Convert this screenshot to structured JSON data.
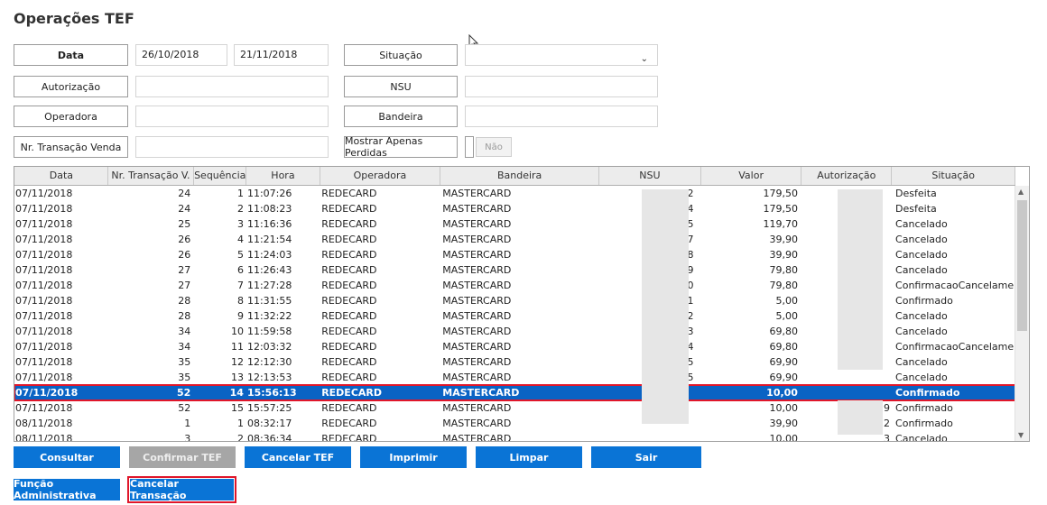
{
  "title": "Operações TEF",
  "filters": {
    "data_label": "Data",
    "date_from": "26/10/2018",
    "date_to": "21/11/2018",
    "autorizacao_label": "Autorização",
    "operadora_label": "Operadora",
    "nr_transacao_label": "Nr. Transação Venda",
    "situacao_label": "Situação",
    "nsu_label": "NSU",
    "bandeira_label": "Bandeira",
    "mostrar_perdidas_label": "Mostrar Apenas Perdidas",
    "mostrar_perdidas_value": "Não"
  },
  "grid": {
    "columns": [
      "Data",
      "Nr. Transação V.",
      "Sequência",
      "Hora",
      "Operadora",
      "Bandeira",
      "NSU",
      "Valor",
      "Autorização",
      "Situação"
    ],
    "rows": [
      {
        "data": "07/11/2018",
        "nr": "24",
        "seq": "1",
        "hora": "11:07:26",
        "op": "REDECARD",
        "band": "MASTERCARD",
        "nsu": "2",
        "valor": "179,50",
        "aut": "",
        "sit": "Desfeita"
      },
      {
        "data": "07/11/2018",
        "nr": "24",
        "seq": "2",
        "hora": "11:08:23",
        "op": "REDECARD",
        "band": "MASTERCARD",
        "nsu": "4",
        "valor": "179,50",
        "aut": "",
        "sit": "Desfeita"
      },
      {
        "data": "07/11/2018",
        "nr": "25",
        "seq": "3",
        "hora": "11:16:36",
        "op": "REDECARD",
        "band": "MASTERCARD",
        "nsu": "5",
        "valor": "119,70",
        "aut": "",
        "sit": "Cancelado"
      },
      {
        "data": "07/11/2018",
        "nr": "26",
        "seq": "4",
        "hora": "11:21:54",
        "op": "REDECARD",
        "band": "MASTERCARD",
        "nsu": "7",
        "valor": "39,90",
        "aut": "",
        "sit": "Cancelado"
      },
      {
        "data": "07/11/2018",
        "nr": "26",
        "seq": "5",
        "hora": "11:24:03",
        "op": "REDECARD",
        "band": "MASTERCARD",
        "nsu": "8",
        "valor": "39,90",
        "aut": "",
        "sit": "Cancelado"
      },
      {
        "data": "07/11/2018",
        "nr": "27",
        "seq": "6",
        "hora": "11:26:43",
        "op": "REDECARD",
        "band": "MASTERCARD",
        "nsu": "9",
        "valor": "79,80",
        "aut": "",
        "sit": "Cancelado"
      },
      {
        "data": "07/11/2018",
        "nr": "27",
        "seq": "7",
        "hora": "11:27:28",
        "op": "REDECARD",
        "band": "MASTERCARD",
        "nsu": "0",
        "valor": "79,80",
        "aut": "",
        "sit": "ConfirmacaoCancelamento"
      },
      {
        "data": "07/11/2018",
        "nr": "28",
        "seq": "8",
        "hora": "11:31:55",
        "op": "REDECARD",
        "band": "MASTERCARD",
        "nsu": "1",
        "valor": "5,00",
        "aut": "",
        "sit": "Confirmado"
      },
      {
        "data": "07/11/2018",
        "nr": "28",
        "seq": "9",
        "hora": "11:32:22",
        "op": "REDECARD",
        "band": "MASTERCARD",
        "nsu": "2",
        "valor": "5,00",
        "aut": "",
        "sit": "Cancelado"
      },
      {
        "data": "07/11/2018",
        "nr": "34",
        "seq": "10",
        "hora": "11:59:58",
        "op": "REDECARD",
        "band": "MASTERCARD",
        "nsu": "3",
        "valor": "69,80",
        "aut": "",
        "sit": "Cancelado"
      },
      {
        "data": "07/11/2018",
        "nr": "34",
        "seq": "11",
        "hora": "12:03:32",
        "op": "REDECARD",
        "band": "MASTERCARD",
        "nsu": "4",
        "valor": "69,80",
        "aut": "",
        "sit": "ConfirmacaoCancelamento"
      },
      {
        "data": "07/11/2018",
        "nr": "35",
        "seq": "12",
        "hora": "12:12:30",
        "op": "REDECARD",
        "band": "MASTERCARD",
        "nsu": "5",
        "valor": "69,90",
        "aut": "",
        "sit": "Cancelado"
      },
      {
        "data": "07/11/2018",
        "nr": "35",
        "seq": "13",
        "hora": "12:13:53",
        "op": "REDECARD",
        "band": "MASTERCARD",
        "nsu": "5",
        "valor": "69,90",
        "aut": "",
        "sit": "Cancelado"
      },
      {
        "data": "07/11/2018",
        "nr": "52",
        "seq": "14",
        "hora": "15:56:13",
        "op": "REDECARD",
        "band": "MASTERCARD",
        "nsu": "",
        "valor": "10,00",
        "aut": "",
        "sit": "Confirmado",
        "selected": true
      },
      {
        "data": "07/11/2018",
        "nr": "52",
        "seq": "15",
        "hora": "15:57:25",
        "op": "REDECARD",
        "band": "MASTERCARD",
        "nsu": "",
        "valor": "10,00",
        "aut": "9",
        "sit": "Confirmado"
      },
      {
        "data": "08/11/2018",
        "nr": "1",
        "seq": "1",
        "hora": "08:32:17",
        "op": "REDECARD",
        "band": "MASTERCARD",
        "nsu": "",
        "valor": "39,90",
        "aut": "2",
        "sit": "Confirmado"
      },
      {
        "data": "08/11/2018",
        "nr": "3",
        "seq": "2",
        "hora": "08:36:34",
        "op": "REDECARD",
        "band": "MASTERCARD",
        "nsu": "",
        "valor": "10,00",
        "aut": "3",
        "sit": "Cancelado"
      }
    ]
  },
  "buttons": {
    "consultar": "Consultar",
    "confirmar_tef": "Confirmar TEF",
    "cancelar_tef": "Cancelar TEF",
    "imprimir": "Imprimir",
    "limpar": "Limpar",
    "sair": "Sair",
    "funcao_admin": "Função Administrativa",
    "cancelar_transacao": "Cancelar Transação"
  },
  "colors": {
    "button_blue": "#0a74d6",
    "selected_row": "#0a63c4",
    "highlight_red": "#e0162a",
    "disabled_gray": "#a6a6a6"
  }
}
